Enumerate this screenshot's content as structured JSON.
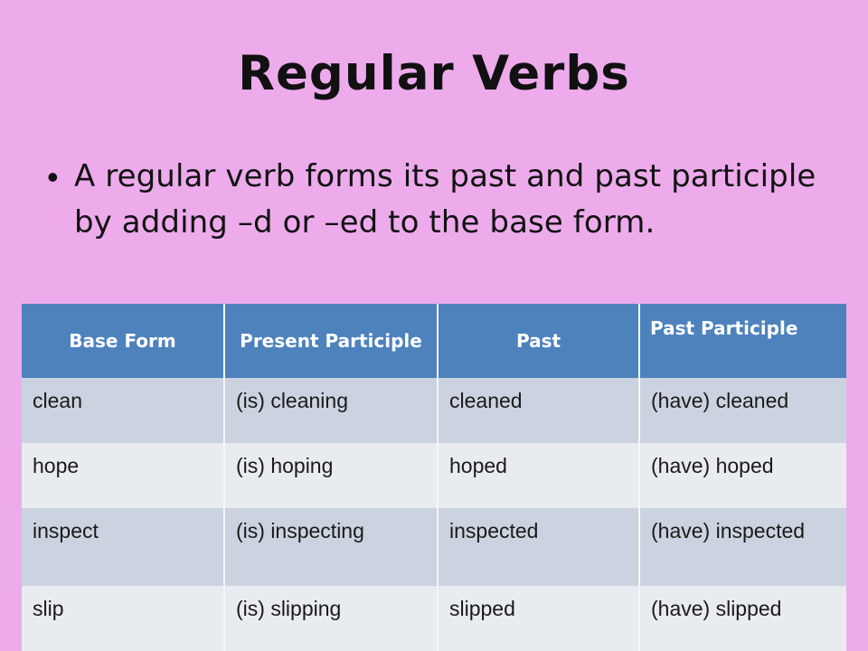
{
  "slide": {
    "background_color": "#edabec",
    "title": "Regular Verbs",
    "bullet": {
      "marker": "•",
      "text": "A regular verb forms its past and past participle by adding –d or –ed to the base form."
    }
  },
  "table": {
    "header_color": "#4d82bd",
    "header_text_color": "#ffffff",
    "row_shaded_color": "#ccd3e0",
    "row_plain_color": "#e8ecf0",
    "columns": [
      {
        "label": "Base Form"
      },
      {
        "label": "Present Participle"
      },
      {
        "label": "Past"
      },
      {
        "label": "Past Participle"
      }
    ],
    "rows": [
      {
        "base": "clean",
        "present_participle": "(is) cleaning",
        "past": "cleaned",
        "past_participle": "(have) cleaned"
      },
      {
        "base": "hope",
        "present_participle": "(is) hoping",
        "past": "hoped",
        "past_participle": "(have) hoped"
      },
      {
        "base": "inspect",
        "present_participle": "(is) inspecting",
        "past": "inspected",
        "past_participle": "(have) inspected"
      },
      {
        "base": "slip",
        "present_participle": "(is) slipping",
        "past": "slipped",
        "past_participle": "(have) slipped"
      }
    ]
  }
}
